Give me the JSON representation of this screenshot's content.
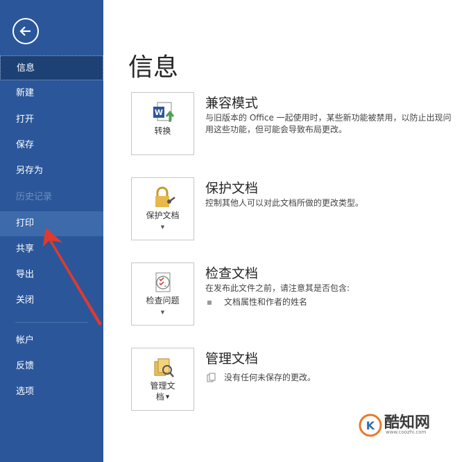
{
  "sidebar": {
    "colors": {
      "bg": "#2b579a",
      "active": "#1e4175",
      "hover": "#3c6aaa"
    },
    "back_icon": "back-arrow-icon",
    "items": [
      {
        "label": "信息"
      },
      {
        "label": "新建"
      },
      {
        "label": "打开"
      },
      {
        "label": "保存"
      },
      {
        "label": "另存为"
      },
      {
        "label": "历史记录"
      },
      {
        "label": "打印"
      },
      {
        "label": "共享"
      },
      {
        "label": "导出"
      },
      {
        "label": "关闭"
      },
      {
        "label": "帐户"
      },
      {
        "label": "反馈"
      },
      {
        "label": "选项"
      }
    ]
  },
  "main": {
    "title": "信息",
    "sections": [
      {
        "title": "兼容模式",
        "desc1": "与旧版本的 Office 一起使用时，某些新功能被禁用，以防止出现问",
        "desc2": "用这些功能，但可能会导致布局更改。",
        "button": "转换",
        "icon": "word-convert-icon"
      },
      {
        "title": "保护文档",
        "desc1": "控制其他人可以对此文档所做的更改类型。",
        "button": "保护文档",
        "icon": "lock-icon"
      },
      {
        "title": "检查文档",
        "desc1": "在发布此文件之前，请注意其是否包含:",
        "bullet": "文档属性和作者的姓名",
        "button": "检查问题",
        "icon": "inspect-document-icon"
      },
      {
        "title": "管理文档",
        "desc1": "没有任何未保存的更改。",
        "button_line1": "管理文",
        "button_line2": "档",
        "icon": "manage-document-icon"
      }
    ]
  },
  "watermark": {
    "text": "酷知网",
    "url": "www.coozhi.com"
  }
}
